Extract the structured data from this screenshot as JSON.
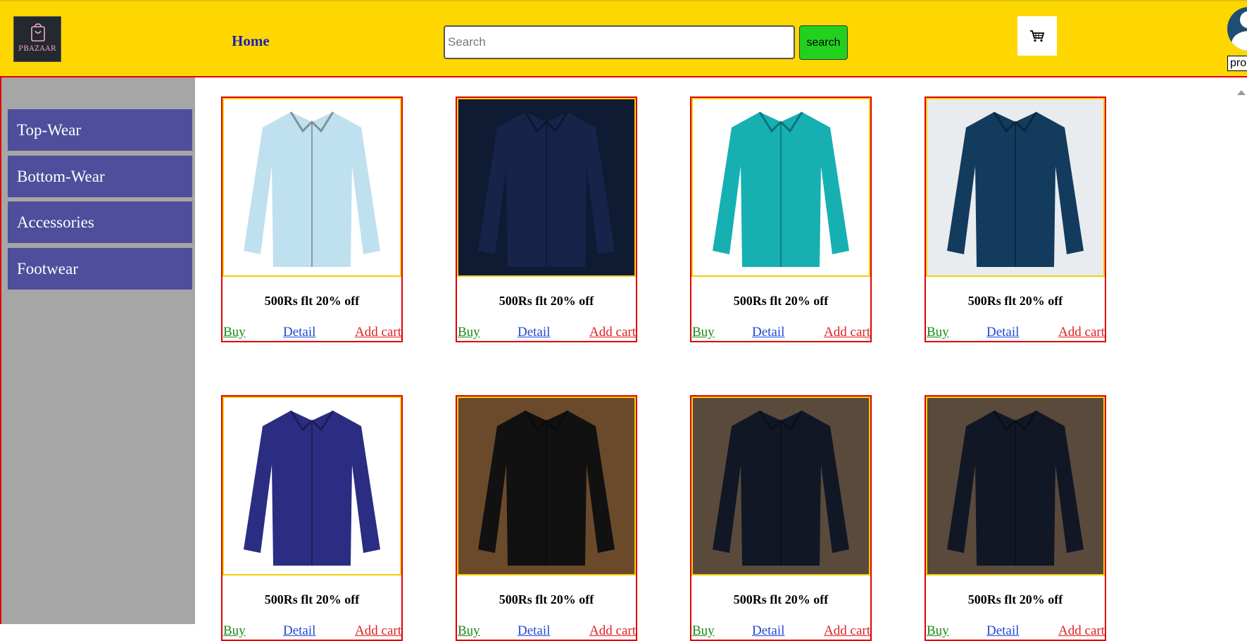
{
  "header": {
    "logo_text": "PBAZAAR",
    "home_label": "Home",
    "search_placeholder": "Search",
    "search_value": "",
    "search_button": "search",
    "profile_select_value": "pro"
  },
  "sidebar": {
    "categories": [
      {
        "label": "Top-Wear"
      },
      {
        "label": "Bottom-Wear"
      },
      {
        "label": "Accessories"
      },
      {
        "label": "Footwear"
      }
    ]
  },
  "products": [
    {
      "offer": "500Rs flt 20% off",
      "buy": "Buy",
      "detail": "Detail",
      "add_cart": "Add cart",
      "shirt_color": "#bfe0ee",
      "bg": "#ffffff"
    },
    {
      "offer": "500Rs flt 20% off",
      "buy": "Buy",
      "detail": "Detail",
      "add_cart": "Add cart",
      "shirt_color": "#16244a",
      "bg": "#0f1a33"
    },
    {
      "offer": "500Rs flt 20% off",
      "buy": "Buy",
      "detail": "Detail",
      "add_cart": "Add cart",
      "shirt_color": "#16b0b3",
      "bg": "#ffffff"
    },
    {
      "offer": "500Rs flt 20% off",
      "buy": "Buy",
      "detail": "Detail",
      "add_cart": "Add cart",
      "shirt_color": "#123b5e",
      "bg": "#e8ecef"
    },
    {
      "offer": "500Rs flt 20% off",
      "buy": "Buy",
      "detail": "Detail",
      "add_cart": "Add cart",
      "shirt_color": "#2b2d82",
      "bg": "#ffffff"
    },
    {
      "offer": "500Rs flt 20% off",
      "buy": "Buy",
      "detail": "Detail",
      "add_cart": "Add cart",
      "shirt_color": "#111111",
      "bg": "#6b4a2b"
    },
    {
      "offer": "500Rs flt 20% off",
      "buy": "Buy",
      "detail": "Detail",
      "add_cart": "Add cart",
      "shirt_color": "#121726",
      "bg": "#5a4a3c"
    },
    {
      "offer": "500Rs flt 20% off",
      "buy": "Buy",
      "detail": "Detail",
      "add_cart": "Add cart",
      "shirt_color": "#121726",
      "bg": "#5a4a3c"
    }
  ],
  "colors": {
    "header_bg": "#ffd700",
    "sidebar_bg": "#a6a6a6",
    "category_bg": "#4e4e9c",
    "search_button_bg": "#22d11e",
    "card_border": "#e00000",
    "image_border": "#f3d00b"
  },
  "icons": [
    "logo-icon",
    "cart-icon",
    "profile-icon",
    "scroll-up-icon"
  ]
}
